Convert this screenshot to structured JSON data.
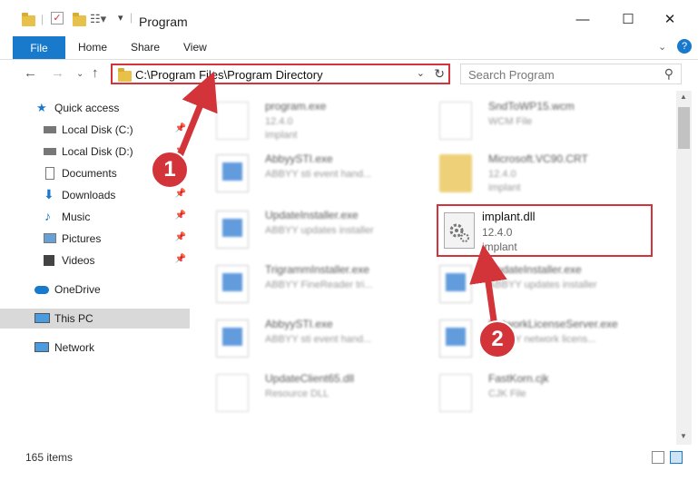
{
  "window": {
    "title": "Program",
    "minimize": "—",
    "maximize": "☐",
    "close": "✕"
  },
  "ribbon": {
    "file": "File",
    "tabs": [
      "Home",
      "Share",
      "View"
    ],
    "help_icon": "?"
  },
  "address": {
    "path": "C:\\Program Files\\Program Directory",
    "search_placeholder": "Search Program"
  },
  "nav": {
    "items": [
      {
        "label": "Quick access",
        "icon": "star-icon",
        "pinned": false
      },
      {
        "label": "Local Disk (C:)",
        "icon": "drive-icon",
        "pinned": true
      },
      {
        "label": "Local Disk (D:)",
        "icon": "drive-icon",
        "pinned": true
      },
      {
        "label": "Documents",
        "icon": "documents-icon",
        "pinned": true
      },
      {
        "label": "Downloads",
        "icon": "download-icon",
        "pinned": true
      },
      {
        "label": "Music",
        "icon": "music-icon",
        "pinned": true
      },
      {
        "label": "Pictures",
        "icon": "pictures-icon",
        "pinned": true
      },
      {
        "label": "Videos",
        "icon": "videos-icon",
        "pinned": true
      },
      {
        "label": "OneDrive",
        "icon": "cloud-icon",
        "pinned": false
      },
      {
        "label": "This PC",
        "icon": "computer-icon",
        "pinned": false,
        "selected": true
      },
      {
        "label": "Network",
        "icon": "network-icon",
        "pinned": false
      }
    ]
  },
  "files": {
    "left": [
      {
        "name": "program.exe",
        "line1": "12.4.0",
        "line2": "implant"
      },
      {
        "name": "AbbyySTI.exe",
        "line1": "ABBYY sti event hand...",
        "line2": ""
      },
      {
        "name": "UpdateInstaller.exe",
        "line1": "ABBYY updates installer",
        "line2": ""
      },
      {
        "name": "TrigrammInstaller.exe",
        "line1": "ABBYY FineReader tri...",
        "line2": ""
      },
      {
        "name": "AbbyySTI.exe",
        "line1": "ABBYY sti event hand...",
        "line2": ""
      },
      {
        "name": "UpdateClient65.dll",
        "line1": "Resource DLL",
        "line2": ""
      }
    ],
    "right": [
      {
        "name": "SndToWP15.wcm",
        "line1": "WCM File",
        "line2": ""
      },
      {
        "name": "Microsoft.VC90.CRT",
        "line1": "12.4.0",
        "line2": "implant"
      },
      {
        "name": "UpdateInstaller.exe",
        "line1": "ABBYY updates installer",
        "line2": ""
      },
      {
        "name": "NetworkLicenseServer.exe",
        "line1": "ABBYY network licens...",
        "line2": ""
      },
      {
        "name": "FastKorn.cjk",
        "line1": "CJK File",
        "line2": ""
      }
    ],
    "highlighted": {
      "name": "implant.dll",
      "line1": "12.4.0",
      "line2": "implant"
    }
  },
  "status": {
    "count": "165 items"
  },
  "callouts": [
    "1",
    "2"
  ],
  "colors": {
    "accent": "#1979ca",
    "highlight": "#d2343a"
  }
}
